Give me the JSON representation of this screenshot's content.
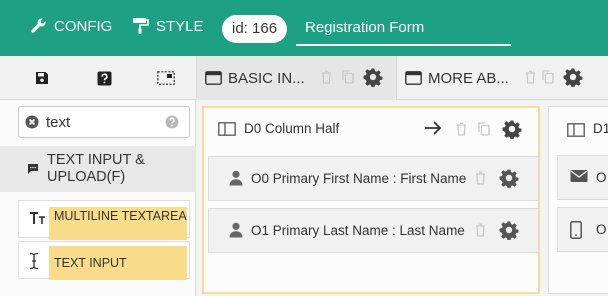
{
  "topbar": {
    "config_label": "CONFIG",
    "style_label": "STYLE",
    "id_label": "id: 166",
    "form_title": "Registration Form"
  },
  "tabs": [
    {
      "label": "BASIC IN..."
    },
    {
      "label": "MORE AB..."
    }
  ],
  "search": {
    "value": "text"
  },
  "category": {
    "label_line1": "TEXT INPUT &",
    "label_line2": "UPLOAD(F)"
  },
  "components": [
    {
      "label": "MULTILINE TEXTAREA",
      "icon": "text-size-icon"
    },
    {
      "label": "TEXT INPUT",
      "icon": "text-cursor-icon"
    }
  ],
  "column": {
    "label": "D0 Column Half",
    "fields": [
      {
        "label": "O0 Primary First Name : First Name",
        "icon": "user-icon"
      },
      {
        "label": "O1 Primary Last Name : Last Name",
        "icon": "user-icon"
      }
    ]
  },
  "column2": {
    "label": "D1",
    "fields": [
      {
        "label": "O",
        "icon": "envelope-icon"
      },
      {
        "label": "O",
        "icon": "mobile-phone-icon"
      }
    ]
  },
  "colors": {
    "accent": "#1ea084",
    "highlight": "#f8dc8a",
    "column_border": "#f6dc95"
  }
}
